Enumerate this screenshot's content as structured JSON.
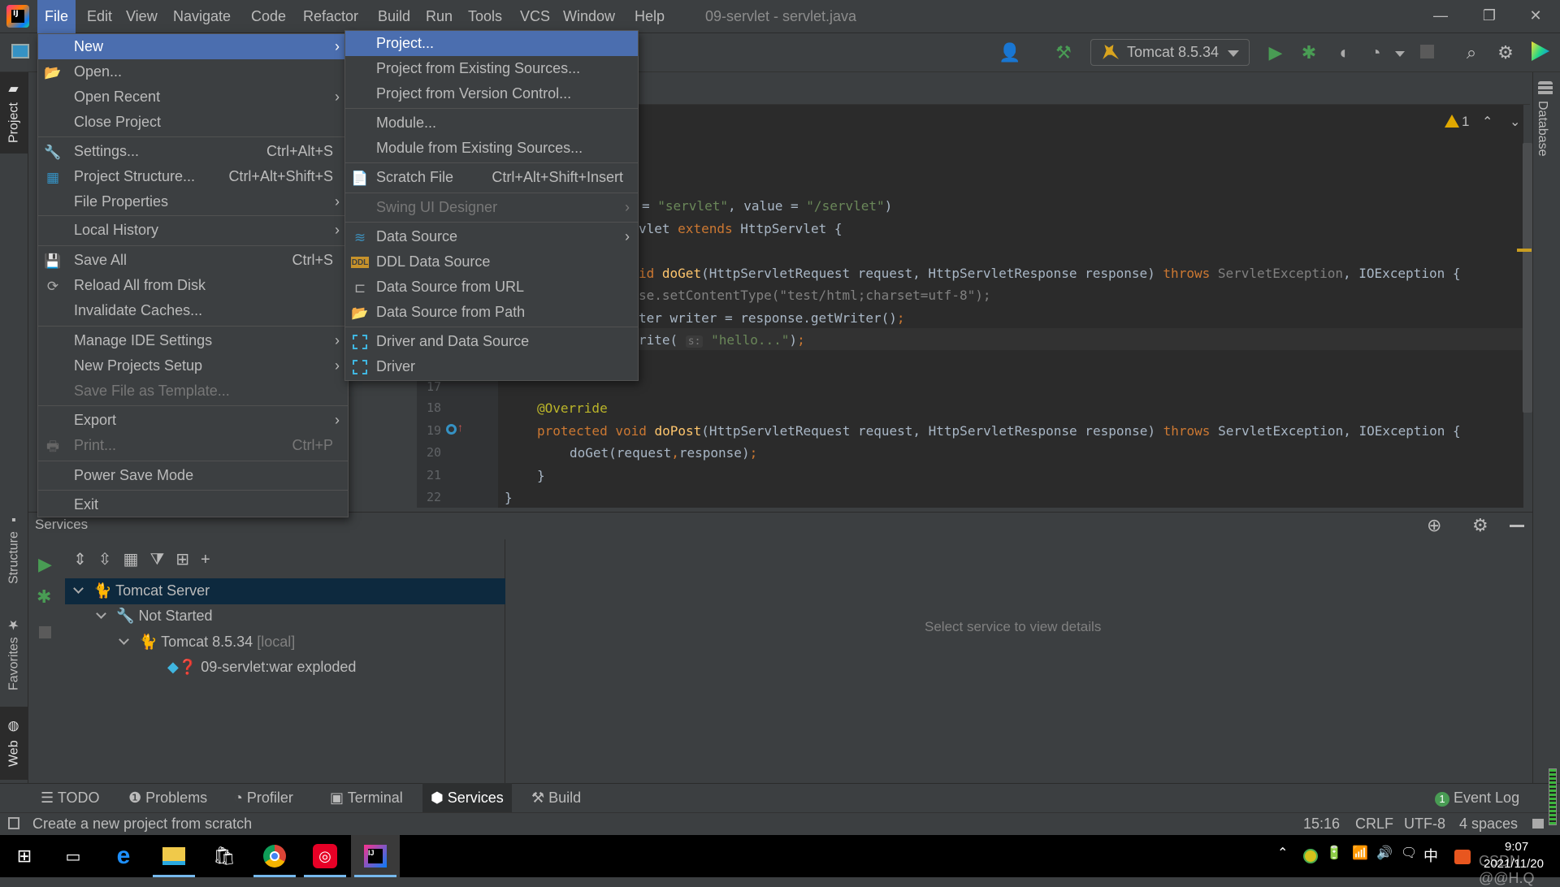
{
  "window": {
    "title": "09-servlet - servlet.java",
    "controls": {
      "minimize": "—",
      "restore": "❐",
      "close": "✕"
    }
  },
  "menubar": [
    {
      "label": "File",
      "mnemonic_index": 0,
      "active": true
    },
    {
      "label": "Edit"
    },
    {
      "label": "View"
    },
    {
      "label": "Navigate"
    },
    {
      "label": "Code"
    },
    {
      "label": "Refactor"
    },
    {
      "label": "Build"
    },
    {
      "label": "Run"
    },
    {
      "label": "Tools"
    },
    {
      "label": "VCS"
    },
    {
      "label": "Window"
    },
    {
      "label": "Help"
    }
  ],
  "toolbar": {
    "run_config": "Tomcat 8.5.34",
    "icons": [
      "user-icon",
      "build-hammer-icon",
      "run-icon",
      "debug-icon",
      "coverage-icon",
      "profile-icon",
      "stop-icon",
      "search-icon",
      "settings-icon",
      "toolbox-icon"
    ]
  },
  "left_strip": {
    "tabs": [
      "Project",
      "Structure",
      "Favorites",
      "Web"
    ]
  },
  "right_strip": {
    "tabs": [
      "Database"
    ]
  },
  "file_menu": {
    "items": [
      {
        "label": "New",
        "submenu": true,
        "selected": true
      },
      {
        "label": "Open...",
        "icon": "folder-open-icon"
      },
      {
        "label": "Open Recent",
        "submenu": true
      },
      {
        "label": "Close Project"
      },
      {
        "label": "Settings...",
        "shortcut": "Ctrl+Alt+S",
        "icon": "wrench-icon"
      },
      {
        "label": "Project Structure...",
        "shortcut": "Ctrl+Alt+Shift+S",
        "icon": "project-structure-icon"
      },
      {
        "label": "File Properties",
        "submenu": true
      },
      {
        "label": "Local History",
        "submenu": true
      },
      {
        "label": "Save All",
        "shortcut": "Ctrl+S",
        "icon": "save-icon"
      },
      {
        "label": "Reload All from Disk",
        "icon": "reload-icon"
      },
      {
        "label": "Invalidate Caches..."
      },
      {
        "label": "Manage IDE Settings",
        "submenu": true
      },
      {
        "label": "New Projects Setup",
        "submenu": true
      },
      {
        "label": "Save File as Template...",
        "disabled": true
      },
      {
        "label": "Export",
        "submenu": true
      },
      {
        "label": "Print...",
        "shortcut": "Ctrl+P",
        "disabled": true,
        "icon": "printer-icon"
      },
      {
        "label": "Power Save Mode"
      },
      {
        "label": "Exit"
      }
    ]
  },
  "new_menu": {
    "items": [
      {
        "label": "Project...",
        "selected": true
      },
      {
        "label": "Project from Existing Sources..."
      },
      {
        "label": "Project from Version Control..."
      },
      {
        "label": "Module..."
      },
      {
        "label": "Module from Existing Sources..."
      },
      {
        "label": "Scratch File",
        "shortcut": "Ctrl+Alt+Shift+Insert",
        "icon": "scratch-file-icon"
      },
      {
        "label": "Swing UI Designer",
        "submenu": true,
        "disabled": true
      },
      {
        "label": "Data Source",
        "submenu": true,
        "icon": "database-icon"
      },
      {
        "label": "DDL Data Source",
        "icon": "ddl-icon"
      },
      {
        "label": "Data Source from URL",
        "icon": "plug-icon"
      },
      {
        "label": "Data Source from Path",
        "icon": "folder-icon"
      },
      {
        "label": "Driver and Data Source",
        "icon": "driver-icon"
      },
      {
        "label": "Driver",
        "icon": "driver-icon"
      }
    ]
  },
  "editor": {
    "warnings": "1",
    "lines": [
      {
        "num": "",
        "text": "= \"servlet\", value = \"/servlet\")"
      },
      {
        "num": "",
        "text": "let extends HttpServlet {"
      },
      {
        "num": "",
        "text": "id doGet(HttpServletRequest request, HttpServletResponse response) throws ServletException, IOException {"
      },
      {
        "num": "",
        "text": "se.setContentType(\"test/html;charset=utf-8\");"
      },
      {
        "num": "",
        "text": "ter writer = response.getWriter();"
      },
      {
        "num": "",
        "text": "rite( s: \"hello...\");"
      },
      {
        "num": "17",
        "text": ""
      },
      {
        "num": "18",
        "text": "@Override"
      },
      {
        "num": "19",
        "text": "protected void doPost(HttpServletRequest request, HttpServletResponse response) throws ServletException, IOException {"
      },
      {
        "num": "20",
        "text": "doGet(request,response);"
      },
      {
        "num": "21",
        "text": "}"
      },
      {
        "num": "22",
        "text": "}"
      }
    ],
    "parts": {
      "l1a": "= ",
      "l1b": "\"servlet\"",
      "l1c": ", value = ",
      "l1d": "\"/servlet\"",
      "l1e": ")",
      "l2a": "vlet ",
      "l2b": "extends",
      "l2c": " HttpServlet {",
      "l3a": "id ",
      "l3b": "doGet",
      "l3c": "(HttpServletRequest request, HttpServletResponse response) ",
      "l3d": "throws",
      "l3e": " ServletException",
      "l3f": ", IOException {",
      "l4": "se.setContentType(\"test/html;charset=utf-8\");",
      "l5a": "ter writer = response.getWriter()",
      "l5b": ";",
      "l6a": "rite( ",
      "l6hint": "s:",
      "l6b": "\"hello...\"",
      "l6c": ")",
      "l6d": ";",
      "l18": "@Override",
      "l19a": "protected void ",
      "l19b": "doPost",
      "l19c": "(HttpServletRequest request, HttpServletResponse response) ",
      "l19d": "throws",
      "l19e": " ServletException, IOException {",
      "l20a": "doGet(request",
      "l20b": ",",
      "l20c": "response)",
      "l20d": ";",
      "l21": "}",
      "l22": "}"
    }
  },
  "services": {
    "title": "Services",
    "tree": [
      {
        "label": "Tomcat Server",
        "level": 0,
        "selected": true,
        "icon": "tomcat-icon"
      },
      {
        "label": "Not Started",
        "level": 1,
        "icon": "wrench-icon"
      },
      {
        "label": "Tomcat 8.5.34",
        "suffix": "[local]",
        "level": 2,
        "icon": "tomcat-icon"
      },
      {
        "label": "09-servlet:war exploded",
        "level": 3,
        "icon": "artifact-icon"
      }
    ],
    "empty_text": "Select service to view details"
  },
  "bottom_tabs": [
    {
      "label": "TODO",
      "icon": "list-icon"
    },
    {
      "label": "Problems",
      "icon": "problems-icon"
    },
    {
      "label": "Profiler",
      "icon": "profiler-icon"
    },
    {
      "label": "Terminal",
      "icon": "terminal-icon"
    },
    {
      "label": "Services",
      "icon": "services-icon",
      "selected": true
    },
    {
      "label": "Build",
      "icon": "hammer-icon"
    }
  ],
  "event_log": {
    "label": "Event Log",
    "count": "1"
  },
  "statusbar": {
    "message": "Create a new project from scratch",
    "position": "15:16",
    "line_separator": "CRLF",
    "encoding": "UTF-8",
    "indent": "4 spaces"
  },
  "taskbar": {
    "clock_time": "9:07",
    "clock_date": "2021/11/20",
    "ime": "中",
    "watermark": "CSDN @@H.Q"
  },
  "colors": {
    "accent": "#4b6eaf",
    "keyword": "#cc7832",
    "string": "#6a8759",
    "annotation": "#bbb529",
    "function": "#ffc66d",
    "run_green": "#499c54"
  }
}
